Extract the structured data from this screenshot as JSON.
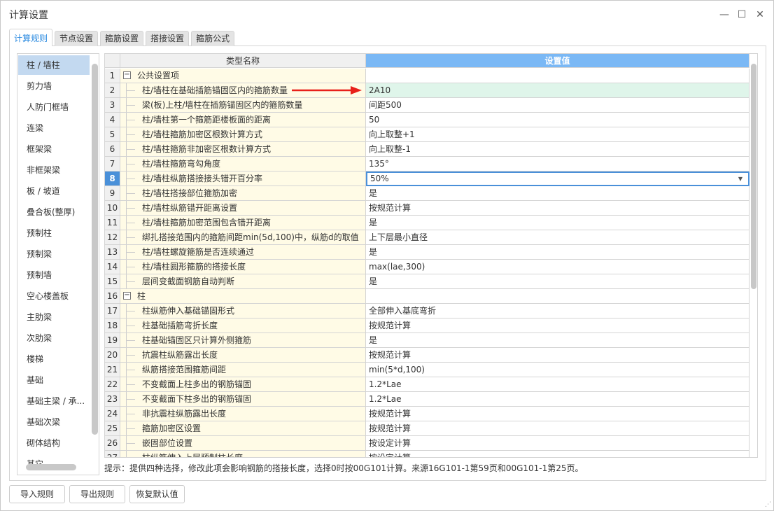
{
  "window": {
    "title": "计算设置",
    "minimize_icon": "minimize-icon",
    "maximize_icon": "maximize-icon",
    "close_icon": "close-icon"
  },
  "tabs": [
    {
      "label": "计算规则",
      "active": true
    },
    {
      "label": "节点设置"
    },
    {
      "label": "箍筋设置"
    },
    {
      "label": "搭接设置"
    },
    {
      "label": "箍筋公式"
    }
  ],
  "sidebar": {
    "selected": "柱 / 墙柱",
    "items": [
      "柱 / 墙柱",
      "剪力墙",
      "人防门框墙",
      "连梁",
      "框架梁",
      "非框架梁",
      "板 / 坡道",
      "叠合板(整厚)",
      "预制柱",
      "预制梁",
      "预制墙",
      "空心楼盖板",
      "主肋梁",
      "次肋梁",
      "楼梯",
      "基础",
      "基础主梁 / 承...",
      "基础次梁",
      "砌体结构",
      "其它"
    ]
  },
  "grid": {
    "headers": {
      "name": "类型名称",
      "value": "设置值"
    },
    "accent": "#7ab8f5",
    "rows": [
      {
        "n": "1",
        "name": "公共设置项",
        "value": "",
        "group": true
      },
      {
        "n": "2",
        "name": "柱/墙柱在基础插筋锚固区内的箍筋数量",
        "value": "2A10",
        "highlight": true,
        "arrow": true
      },
      {
        "n": "3",
        "name": "梁(板)上柱/墙柱在插筋锚固区内的箍筋数量",
        "value": "间距500"
      },
      {
        "n": "4",
        "name": "柱/墙柱第一个箍筋距楼板面的距离",
        "value": "50"
      },
      {
        "n": "5",
        "name": "柱/墙柱箍筋加密区根数计算方式",
        "value": "向上取整+1"
      },
      {
        "n": "6",
        "name": "柱/墙柱箍筋非加密区根数计算方式",
        "value": "向上取整-1"
      },
      {
        "n": "7",
        "name": "柱/墙柱箍筋弯勾角度",
        "value": "135°"
      },
      {
        "n": "8",
        "name": "柱/墙柱纵筋搭接接头错开百分率",
        "value": "50%",
        "selected": true
      },
      {
        "n": "9",
        "name": "柱/墙柱搭接部位箍筋加密",
        "value": "是"
      },
      {
        "n": "10",
        "name": "柱/墙柱纵筋错开距离设置",
        "value": "按规范计算"
      },
      {
        "n": "11",
        "name": "柱/墙柱箍筋加密范围包含错开距离",
        "value": "是"
      },
      {
        "n": "12",
        "name": "绑扎搭接范围内的箍筋间距min(5d,100)中，纵筋d的取值",
        "value": "上下层最小直径"
      },
      {
        "n": "13",
        "name": "柱/墙柱螺旋箍筋是否连续通过",
        "value": "是"
      },
      {
        "n": "14",
        "name": "柱/墙柱圆形箍筋的搭接长度",
        "value": "max(lae,300)"
      },
      {
        "n": "15",
        "name": "层间变截面钢筋自动判断",
        "value": "是"
      },
      {
        "n": "16",
        "name": "柱",
        "value": "",
        "group": true
      },
      {
        "n": "17",
        "name": "柱纵筋伸入基础锚固形式",
        "value": "全部伸入基底弯折"
      },
      {
        "n": "18",
        "name": "柱基础插筋弯折长度",
        "value": "按规范计算"
      },
      {
        "n": "19",
        "name": "柱基础锚固区只计算外侧箍筋",
        "value": "是"
      },
      {
        "n": "20",
        "name": "抗震柱纵筋露出长度",
        "value": "按规范计算"
      },
      {
        "n": "21",
        "name": "纵筋搭接范围箍筋间距",
        "value": "min(5*d,100)"
      },
      {
        "n": "22",
        "name": "不变截面上柱多出的钢筋锚固",
        "value": "1.2*Lae"
      },
      {
        "n": "23",
        "name": "不变截面下柱多出的钢筋锚固",
        "value": "1.2*Lae"
      },
      {
        "n": "24",
        "name": "非抗震柱纵筋露出长度",
        "value": "按规范计算"
      },
      {
        "n": "25",
        "name": "箍筋加密区设置",
        "value": "按规范计算"
      },
      {
        "n": "26",
        "name": "嵌固部位设置",
        "value": "按设定计算"
      },
      {
        "n": "27",
        "name": "柱纵筋伸入上层预制柱长度",
        "value": "按设定计算"
      }
    ]
  },
  "hint": "提示：提供四种选择，修改此项会影响钢筋的搭接长度，选择0时按00G101计算。来源16G101-1第59页和00G101-1第25页。",
  "buttons": {
    "import": "导入规则",
    "export": "导出规则",
    "reset": "恢复默认值"
  }
}
